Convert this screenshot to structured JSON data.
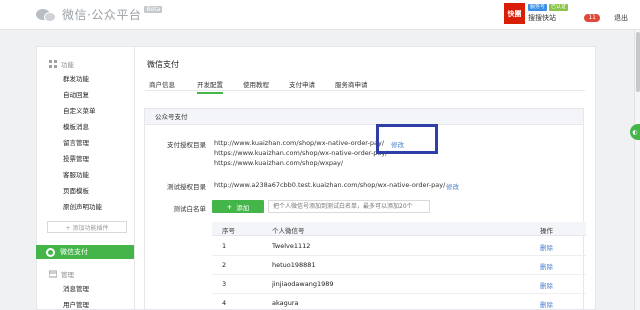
{
  "header": {
    "logo_text": "微信·公众平台",
    "beta": "Beta",
    "avatar_text": "快團",
    "tags": [
      "服务号",
      "已认证"
    ],
    "account_name": "搜搜快站",
    "badge": "11",
    "logout": "退出"
  },
  "sidebar": {
    "section_function": "功能",
    "items": [
      "群发功能",
      "自动回复",
      "自定义菜单",
      "模板消息",
      "留言管理",
      "投票管理",
      "客服功能",
      "页面模板",
      "原创声明功能"
    ],
    "add_plugin": "+ 添加功能插件",
    "active": "微信支付",
    "section_manage": "管理",
    "manage_items": [
      "消息管理",
      "用户管理"
    ]
  },
  "main": {
    "title": "微信支付",
    "tabs": [
      "商户信息",
      "开发配置",
      "使用教程",
      "支付申请",
      "服务商申请"
    ],
    "active_tab": "开发配置",
    "section_title": "公众号支付",
    "auth_dir_label": "支付授权目录",
    "auth_urls": [
      "http://www.kuaizhan.com/shop/wx-native-order-pay/",
      "https://www.kuaizhan.com/shop/wx-native-order-pay/",
      "https://www.kuaizhan.com/shop/wxpay/"
    ],
    "modify": "修改",
    "test_dir_label": "测试授权目录",
    "test_url": "http://www.a238a67cbb0.test.kuaizhan.com/shop/wx-native-order-pay/",
    "whitelist_label": "测试白名单",
    "add_button": "添加",
    "whitelist_placeholder": "把个人微信号添加到测试白名单，最多可以添加20个",
    "table": {
      "headers": [
        "序号",
        "个人微信号",
        "操作"
      ],
      "rows": [
        {
          "no": "1",
          "wechat": "Twelve1112",
          "action": "删除"
        },
        {
          "no": "2",
          "wechat": "hetuo198881",
          "action": "删除"
        },
        {
          "no": "3",
          "wechat": "jinjiaodawang1989",
          "action": "删除"
        },
        {
          "no": "4",
          "wechat": "akagura",
          "action": "删除"
        }
      ]
    }
  },
  "colors": {
    "accent_green": "#44b549",
    "link_blue": "#4a7fd0",
    "highlight_box": "#2e3fa8"
  }
}
